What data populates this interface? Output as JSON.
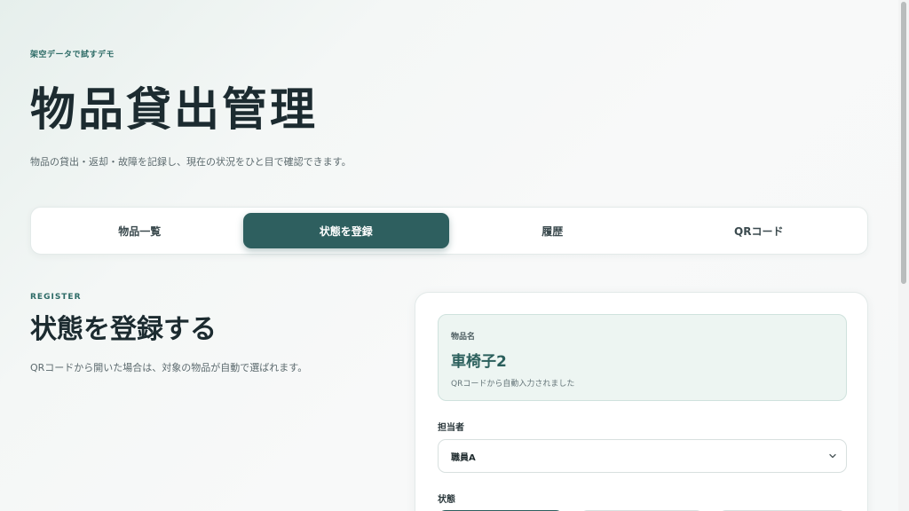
{
  "hero": {
    "eyebrow": "架空データで試すデモ",
    "title": "物品貸出管理",
    "lead": "物品の貸出・返却・故障を記録し、現在の状況をひと目で確認できます。"
  },
  "tabs": [
    {
      "label": "物品一覧",
      "active": false
    },
    {
      "label": "状態を登録",
      "active": true
    },
    {
      "label": "履歴",
      "active": false
    },
    {
      "label": "QRコード",
      "active": false
    }
  ],
  "register": {
    "eyebrow": "REGISTER",
    "title": "状態を登録する",
    "desc": "QRコードから開いた場合は、対象の物品が自動で選ばれます。"
  },
  "form": {
    "item_label": "物品名",
    "item_value": "車椅子2",
    "item_note": "QRコードから自動入力されました",
    "staff_label": "担当者",
    "staff_value": "職員A",
    "status_label": "状態"
  },
  "icons": {
    "select_chevron": "chevron-down-icon"
  },
  "colors": {
    "accent": "#2e5f5f",
    "accent_text": "#2d6b66",
    "item_box_bg": "#edf5f2"
  }
}
